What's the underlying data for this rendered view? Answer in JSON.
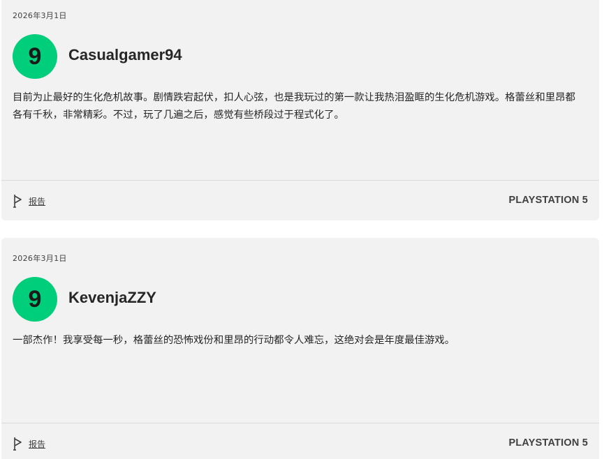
{
  "reviews": [
    {
      "date": "2026年3月1日",
      "score": "9",
      "username": "Casualgamer94",
      "text": "目前为止最好的生化危机故事。剧情跌宕起伏，扣人心弦，也是我玩过的第一款让我热泪盈眶的生化危机游戏。格蕾丝和里昂都各有千秋，非常精彩。不过，玩了几遍之后，感觉有些桥段过于程式化了。",
      "report_label": "报告",
      "platform": "PLAYSTATION 5"
    },
    {
      "date": "2026年3月1日",
      "score": "9",
      "username": "KevenjaZZY",
      "text": "一部杰作！我享受每一秒，格蕾丝的恐怖戏份和里昂的行动都令人难忘，这绝对会是年度最佳游戏。",
      "report_label": "报告",
      "platform": "PLAYSTATION 5"
    }
  ],
  "colors": {
    "score_badge": "#00ce7a",
    "card_background": "#f2f2f2"
  },
  "icons": {
    "report": "flag-icon"
  }
}
